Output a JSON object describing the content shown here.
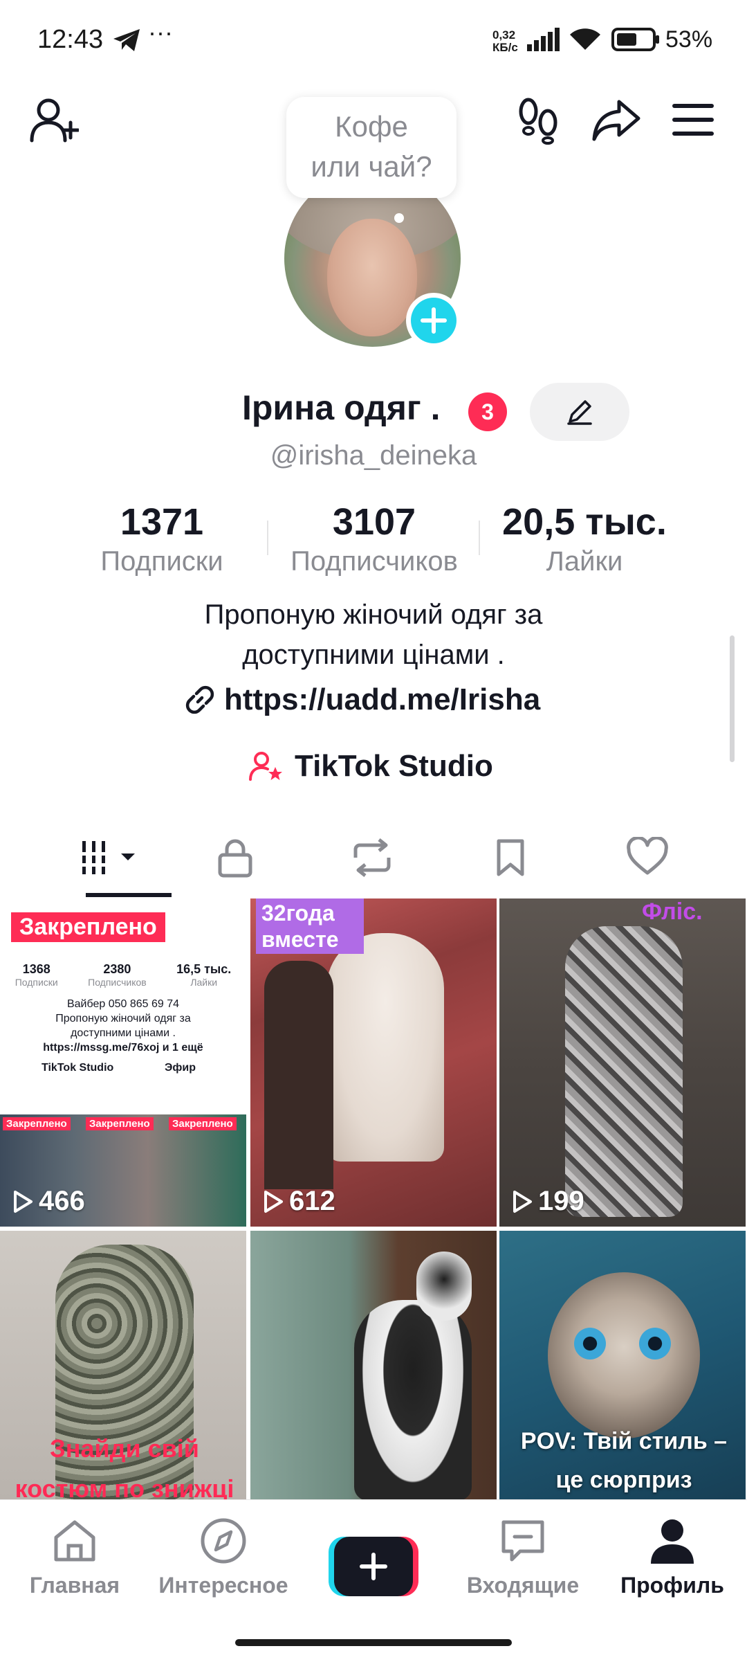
{
  "status_bar": {
    "time": "12:43",
    "net_speed_value": "0,32",
    "net_speed_unit": "КБ/с",
    "battery": "53%"
  },
  "profile": {
    "bubble_line1": "Кофе",
    "bubble_line2": "или чай?",
    "name": "Ірина одяг .",
    "badge_count": "3",
    "username": "@irisha_deineka",
    "stats": [
      {
        "value": "1371",
        "label": "Подписки"
      },
      {
        "value": "3107",
        "label": "Подписчиков"
      },
      {
        "value": "20,5 тыс.",
        "label": "Лайки"
      }
    ],
    "bio_line1": "Пропоную жіночий одяг за",
    "bio_line2": "доступними цінами .",
    "link": "https://uadd.me/Irisha",
    "studio": "TikTok Studio"
  },
  "videos": [
    {
      "views": "466",
      "pinned_label": "Закреплено"
    },
    {
      "views": "612",
      "caption": "32года вместе"
    },
    {
      "views": "199",
      "caption": "Фліс."
    },
    {
      "caption": "Знайди свій костюм по знижці"
    },
    {},
    {
      "caption": "POV: Твій стиль – це сюрприз"
    }
  ],
  "pinned_preview": {
    "stats": [
      {
        "value": "1368",
        "label": "Подписки"
      },
      {
        "value": "2380",
        "label": "Подписчиков"
      },
      {
        "value": "16,5 тыс.",
        "label": "Лайки"
      }
    ],
    "line1": "Вайбер 050 865 69 74",
    "line2": "Пропоную жіночий одяг за",
    "line3": "доступними цінами .",
    "link": "https://mssg.me/76xoj и 1 ещё",
    "studio": "TikTok Studio",
    "live": "Эфир",
    "pinned": "Закреплено"
  },
  "bottom_nav": [
    {
      "label": "Главная"
    },
    {
      "label": "Интересное"
    },
    {
      "label": "Входящие"
    },
    {
      "label": "Профиль"
    }
  ],
  "colors": {
    "accent_red": "#fe2c55",
    "accent_cyan": "#20d5ec",
    "text_primary": "#161823",
    "text_secondary": "#8a8b91"
  }
}
